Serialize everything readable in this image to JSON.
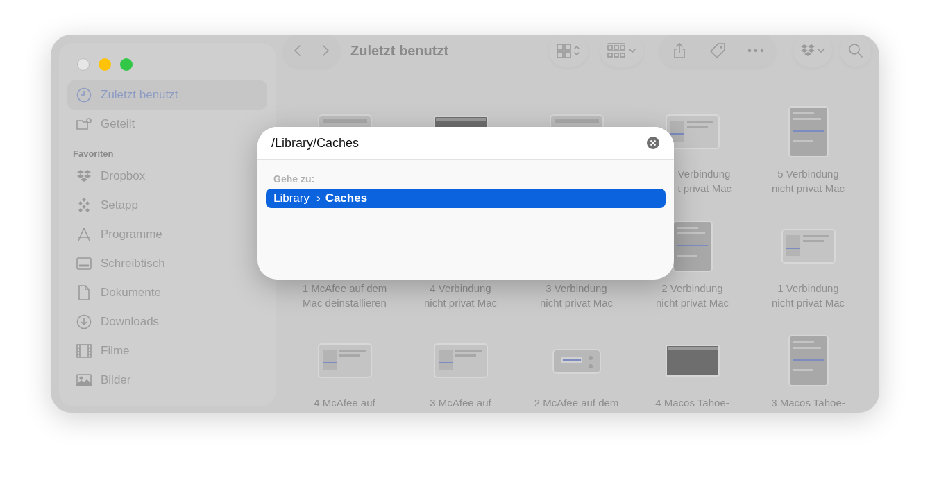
{
  "window": {
    "title": "Zuletzt benutzt"
  },
  "sidebar": {
    "items": [
      {
        "label": "Zuletzt benutzt",
        "kind": "clock",
        "selected": true
      },
      {
        "label": "Geteilt",
        "kind": "shared",
        "selected": false
      }
    ],
    "favorites_heading": "Favoriten",
    "favorites": [
      {
        "label": "Dropbox",
        "kind": "dropbox",
        "selected": false
      },
      {
        "label": "Setapp",
        "kind": "setapp",
        "selected": false
      },
      {
        "label": "Programme",
        "kind": "apps",
        "selected": false
      },
      {
        "label": "Schreibtisch",
        "kind": "desktop",
        "selected": false
      },
      {
        "label": "Dokumente",
        "kind": "doc",
        "selected": false
      },
      {
        "label": "Downloads",
        "kind": "download",
        "selected": false
      },
      {
        "label": "Filme",
        "kind": "film",
        "selected": false
      },
      {
        "label": "Bilder",
        "kind": "photo",
        "selected": false
      }
    ]
  },
  "files": [
    {
      "kind": "wide"
    },
    {
      "kind": "dark"
    },
    {
      "kind": "wide"
    },
    {
      "kind": "window",
      "name_lines": [
        "Verbindung",
        "t privat Mac"
      ]
    },
    {
      "kind": "tall",
      "name_lines": [
        "5 Verbindung",
        "nicht privat Mac"
      ]
    },
    {
      "name_lines": [
        "1 McAfee auf dem",
        "Mac deinstallieren"
      ]
    },
    {
      "name_lines": [
        "4 Verbindung",
        "nicht privat Mac"
      ]
    },
    {
      "name_lines": [
        "3 Verbindung",
        "nicht privat Mac"
      ]
    },
    {
      "kind": "tall",
      "name_lines": [
        "2 Verbindung",
        "nicht privat Mac"
      ]
    },
    {
      "kind": "window",
      "name_lines": [
        "1 Verbindung",
        "nicht privat Mac"
      ]
    },
    {
      "kind": "window",
      "name_lines": [
        "4 McAfee auf"
      ]
    },
    {
      "kind": "window",
      "name_lines": [
        "3 McAfee auf"
      ]
    },
    {
      "kind": "small",
      "name_lines": [
        "2 McAfee auf dem"
      ]
    },
    {
      "kind": "dark",
      "name_lines": [
        "4 Macos Tahoe-"
      ]
    },
    {
      "kind": "tall",
      "name_lines": [
        "3 Macos Tahoe-"
      ]
    }
  ],
  "goto_dialog": {
    "path_value": "/Library/Caches",
    "section_label": "Gehe zu:",
    "results": [
      {
        "parts": [
          "Library",
          "›",
          "Caches"
        ],
        "selected": true
      }
    ]
  }
}
